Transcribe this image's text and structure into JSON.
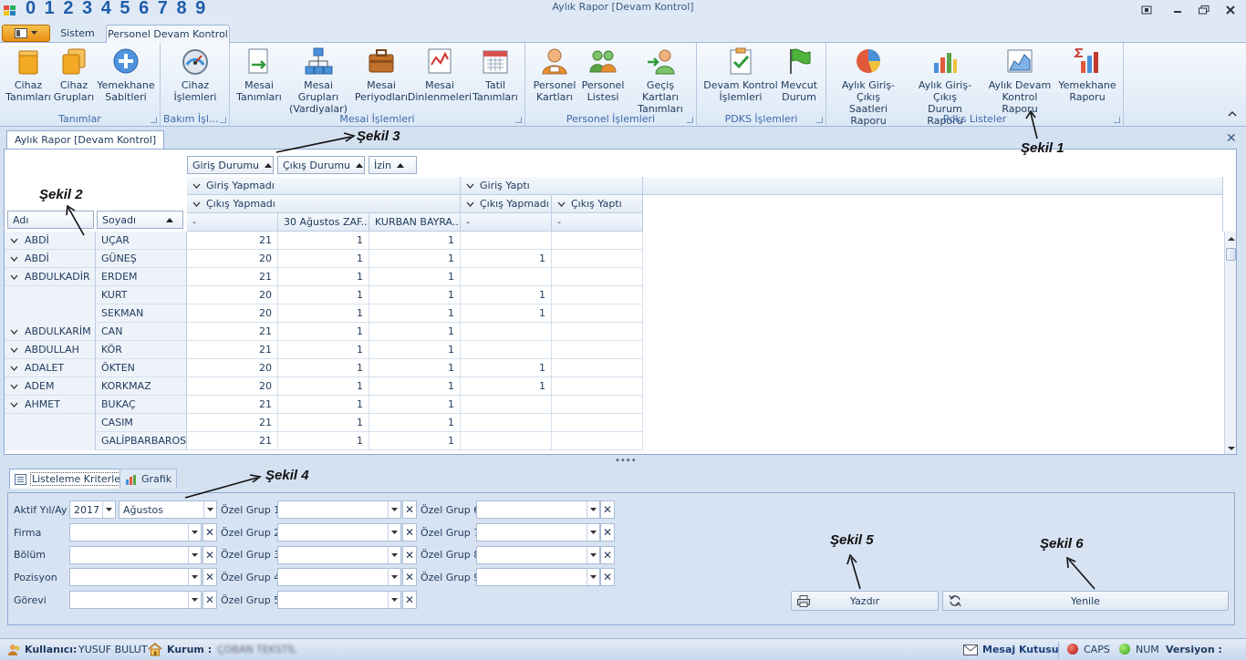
{
  "title_digits": "0 1 2 3 4 5 6 7 8 9",
  "window_title": "Aylık Rapor [Devam Kontrol]",
  "tabs": {
    "sistem": "Sistem",
    "personel": "Personel Devam Kontrol"
  },
  "ribbon": {
    "groups": {
      "tanimlar": "Tanımlar",
      "bakim": "Bakım İşl...",
      "mesai": "Mesai İşlemleri",
      "personel": "Personel İşlemleri",
      "pdks": "PDKS İşlemleri",
      "listeler": "Pdks Listeler"
    },
    "buttons": {
      "cihaz_tanimlari": [
        "Cihaz",
        "Tanımları"
      ],
      "cihaz_gruplari": [
        "Cihaz",
        "Grupları"
      ],
      "yemekhane_sabitleri": [
        "Yemekhane",
        "Sabitleri"
      ],
      "cihaz_islemleri": [
        "Cihaz",
        "İşlemleri"
      ],
      "mesai_tanimlari": [
        "Mesai",
        "Tanımları"
      ],
      "mesai_gruplari": [
        "Mesai Grupları",
        "(Vardiyalar)"
      ],
      "mesai_periyodlari": [
        "Mesai",
        "Periyodları"
      ],
      "mesai_dinlenmeleri": [
        "Mesai",
        "Dinlenmeleri"
      ],
      "tatil_tanimlari": [
        "Tatil",
        "Tanımları"
      ],
      "personel_kartlari": [
        "Personel",
        "Kartları"
      ],
      "personel_listesi": [
        "Personel",
        "Listesi"
      ],
      "gecis_kartlari": [
        "Geçiş Kartları",
        "Tanımları"
      ],
      "devam_kontrol": [
        "Devam Kontrol",
        "İşlemleri"
      ],
      "mevcut_durum": [
        "Mevcut",
        "Durum"
      ],
      "giris_cikis_saatleri": [
        "Aylık Giriş-Çıkış",
        "Saatleri Raporu"
      ],
      "giris_cikis_durum": [
        "Aylık Giriş-Çıkış",
        "Durum Raporu"
      ],
      "devam_kontrol_raporu": [
        "Aylık Devam",
        "Kontrol Raporu"
      ],
      "yemekhane_raporu": [
        "Yemekhane",
        "Raporu"
      ]
    }
  },
  "doc_tab": "Aylık Rapor [Devam Kontrol]",
  "pivot": {
    "filter_fields": [
      "Giriş Durumu",
      "Çıkış Durumu",
      "İzin"
    ],
    "row_fields": [
      "Adı",
      "Soyadı"
    ],
    "col_l1": [
      "Giriş Yapmadı",
      "Giriş Yaptı"
    ],
    "col_l2": [
      "Çıkış Yapmadı",
      "Çıkış Yapmadı",
      "Çıkış Yaptı"
    ],
    "col_l3": [
      "-",
      "30 Ağustos ZAF...",
      "KURBAN BAYRA...",
      "-",
      "-"
    ],
    "rows": [
      {
        "adi": "ABDİ",
        "soyadi": "UÇAR",
        "v": [
          "21",
          "1",
          "1",
          "",
          ""
        ]
      },
      {
        "adi": "ABDİ",
        "soyadi": "GÜNEŞ",
        "v": [
          "20",
          "1",
          "1",
          "1",
          ""
        ]
      },
      {
        "adi": "ABDULKADİR",
        "soyadi": "ERDEM",
        "v": [
          "21",
          "1",
          "1",
          "",
          ""
        ]
      },
      {
        "adi": "",
        "soyadi": "KURT",
        "v": [
          "20",
          "1",
          "1",
          "1",
          ""
        ]
      },
      {
        "adi": "",
        "soyadi": "SEKMAN",
        "v": [
          "20",
          "1",
          "1",
          "1",
          ""
        ]
      },
      {
        "adi": "ABDULKARİM",
        "soyadi": "CAN",
        "v": [
          "21",
          "1",
          "1",
          "",
          ""
        ]
      },
      {
        "adi": "ABDULLAH",
        "soyadi": "KÖR",
        "v": [
          "21",
          "1",
          "1",
          "",
          ""
        ]
      },
      {
        "adi": "ADALET",
        "soyadi": "ÖKTEN",
        "v": [
          "20",
          "1",
          "1",
          "1",
          ""
        ]
      },
      {
        "adi": "ADEM",
        "soyadi": "KORKMAZ",
        "v": [
          "20",
          "1",
          "1",
          "1",
          ""
        ]
      },
      {
        "adi": "AHMET",
        "soyadi": "BUKAÇ",
        "v": [
          "21",
          "1",
          "1",
          "",
          ""
        ]
      },
      {
        "adi": "",
        "soyadi": "CASIM",
        "v": [
          "21",
          "1",
          "1",
          "",
          ""
        ]
      },
      {
        "adi": "",
        "soyadi": "GALİPBARBAROS",
        "v": [
          "21",
          "1",
          "1",
          "",
          ""
        ]
      }
    ]
  },
  "bottom_tabs": {
    "criteria": "Listeleme Kriterleri",
    "chart": "Grafik"
  },
  "criteria": {
    "aktif_label": "Aktif Yıl/Ay",
    "year": "2017",
    "month": "Ağustos",
    "firma": "Firma",
    "bolum": "Bölüm",
    "pozisyon": "Pozisyon",
    "gorevi": "Görevi",
    "ozel": [
      "Özel Grup 1",
      "Özel Grup 2",
      "Özel Grup 3",
      "Özel Grup 4",
      "Özel Grup 5",
      "Özel Grup 6",
      "Özel Grup 7",
      "Özel Grup 8",
      "Özel Grup 9"
    ],
    "print": "Yazdır",
    "refresh": "Yenile"
  },
  "status": {
    "user_label": "Kullanıcı:",
    "user": "YUSUF BULUT",
    "kurum_label": "Kurum :",
    "kurum": "ÇOBAN TEKSTİL",
    "mesaj": "Mesaj Kutusu",
    "caps": "CAPS",
    "num": "NUM",
    "version": "Versiyon :"
  },
  "annotations": [
    "Şekil 1",
    "Şekil 2",
    "Şekil 3",
    "Şekil 4",
    "Şekil 5",
    "Şekil 6"
  ]
}
